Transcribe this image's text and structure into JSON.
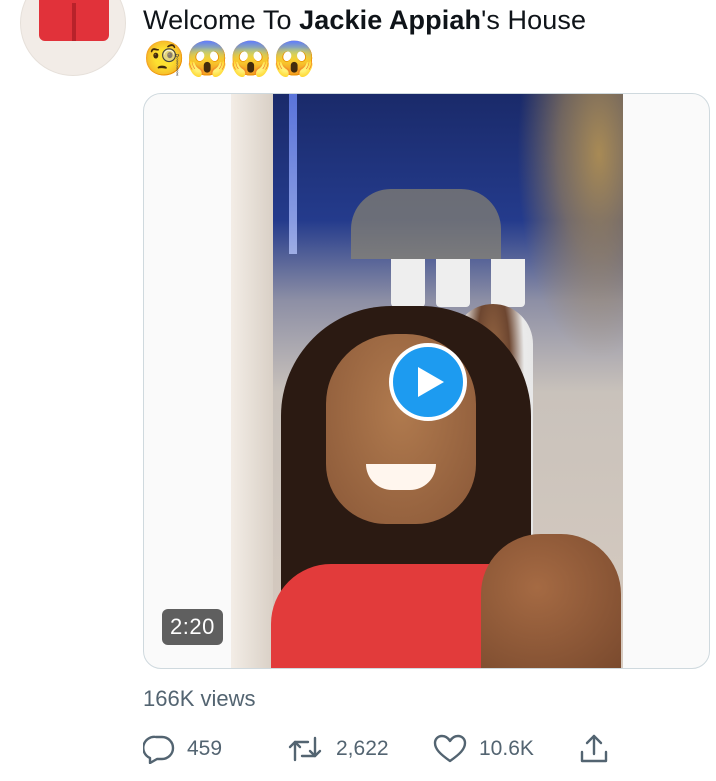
{
  "tweet": {
    "text_prefix": "Welcome To ",
    "text_bold": "Jackie Appiah",
    "text_suffix": "'s House",
    "emojis": "🧐😱😱😱"
  },
  "video": {
    "duration": "2:20"
  },
  "stats": {
    "views": "166K views",
    "replies": "459",
    "retweets": "2,622",
    "likes": "10.6K"
  },
  "icons": {
    "reply": "reply-icon",
    "retweet": "retweet-icon",
    "like": "heart-icon",
    "share": "share-icon",
    "play": "play-icon"
  },
  "colors": {
    "accent": "#1d9bf0",
    "muted": "#536471",
    "border": "#cfd9de"
  }
}
